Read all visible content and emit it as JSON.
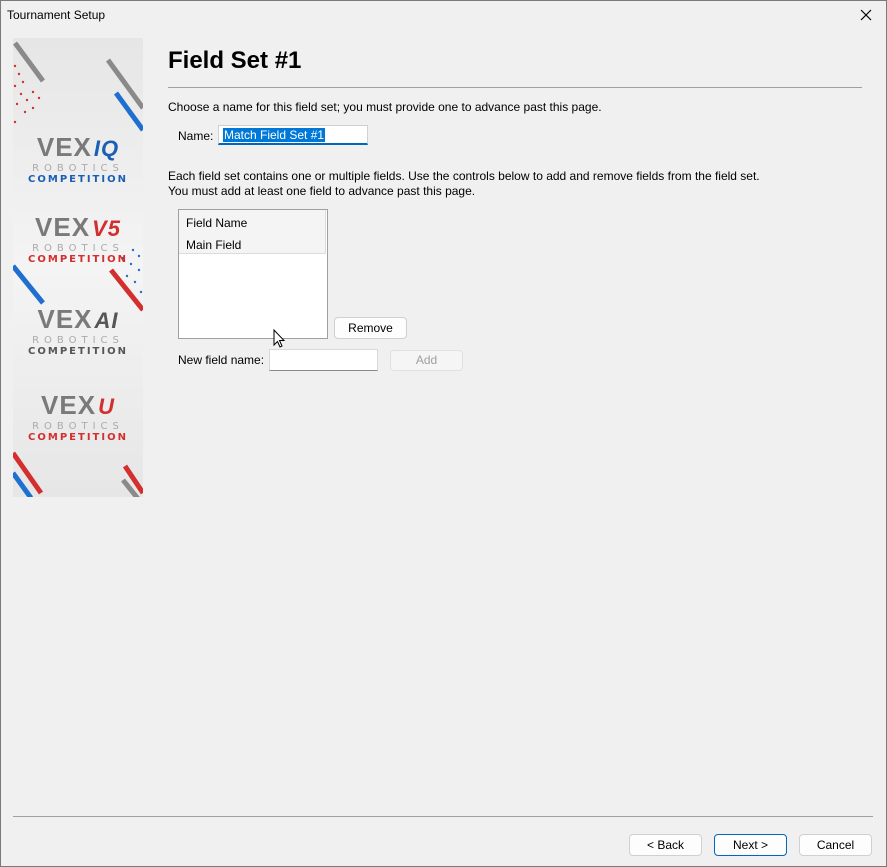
{
  "window": {
    "title": "Tournament Setup"
  },
  "sidebar": {
    "logos": [
      {
        "wordmark": "VEX",
        "suffix": "IQ",
        "robotics": "ROBOTICS",
        "competition": "COMPETITION",
        "suffix_color": "#1a5fb4",
        "competition_color": "#1a5fb4"
      },
      {
        "wordmark": "VEX",
        "suffix": "V5",
        "robotics": "ROBOTICS",
        "competition": "COMPETITION",
        "suffix_color": "#d32f2f",
        "competition_color": "#d32f2f"
      },
      {
        "wordmark": "VEX",
        "suffix": "AI",
        "robotics": "ROBOTICS",
        "competition": "COMPETITION",
        "suffix_color": "#555555",
        "competition_color": "#555555"
      },
      {
        "wordmark": "VEX",
        "suffix": "U",
        "robotics": "ROBOTICS",
        "competition": "COMPETITION",
        "suffix_color": "#d32f2f",
        "competition_color": "#d32f2f"
      }
    ]
  },
  "page": {
    "title": "Field Set #1",
    "name_instructions": "Choose a name for this field set; you must provide one to advance past this page.",
    "name_label": "Name:",
    "name_value": "Match Field Set #1",
    "fields_instructions_1": "Each field set contains one or multiple fields.  Use the controls below to add and remove fields from the field set.",
    "fields_instructions_2": "You must add at least one field to advance past this page.",
    "list_header": "Field Name",
    "fields": [
      "Main Field"
    ],
    "remove_label": "Remove",
    "new_field_label": "New field name:",
    "new_field_value": "",
    "add_label": "Add"
  },
  "footer": {
    "back_label": "< Back",
    "next_label": "Next >",
    "cancel_label": "Cancel"
  },
  "colors": {
    "accent": "#0067c0",
    "selection": "#0078d7",
    "vex_red": "#d32f2f",
    "vex_blue": "#1a5fb4"
  }
}
